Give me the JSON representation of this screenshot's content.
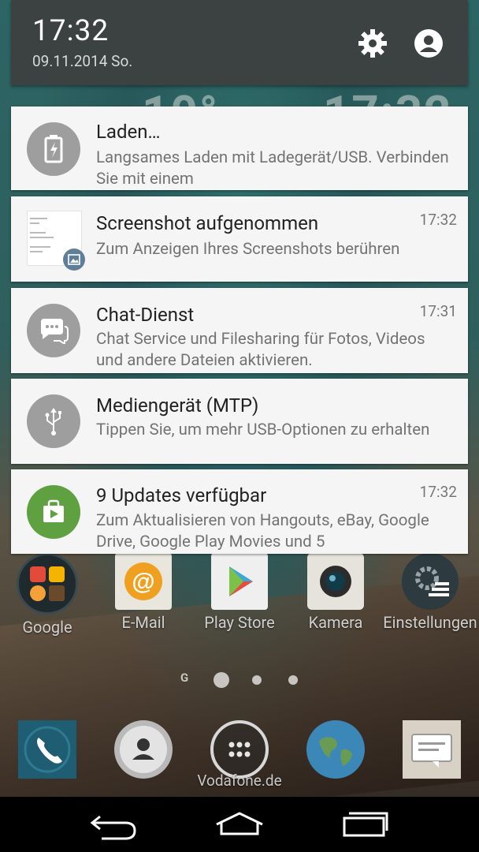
{
  "status": {
    "time": "17:32",
    "date": "09.11.2014 So."
  },
  "header_icons": [
    "gear-icon",
    "account-icon"
  ],
  "wallpaper": {
    "ghost_clock_left": "10°",
    "ghost_clock_right": "17:32"
  },
  "notifications": [
    {
      "title": "Laden…",
      "body": "Langsames Laden mit Ladegerät/USB. Verbinden Sie mit einem",
      "time": "",
      "icon": "battery-charging-icon"
    },
    {
      "title": "Screenshot aufgenommen",
      "body": "Zum Anzeigen Ihres Screenshots berühren",
      "time": "17:32",
      "icon": "image-icon"
    },
    {
      "title": "Chat-Dienst",
      "body": "Chat Service und Filesharing für Fotos, Videos und andere Dateien aktivieren.",
      "time": "17:31",
      "icon": "chat-bubbles-icon"
    },
    {
      "title": "Mediengerät (MTP)",
      "body": "Tippen Sie, um mehr USB-Optionen zu erhalten",
      "time": "",
      "icon": "usb-icon"
    },
    {
      "title": "9 Updates verfügbar",
      "body": "Zum Aktualisieren von Hangouts, eBay, Google Drive, Google Play Movies und 5",
      "time": "17:32",
      "icon": "play-store-bag-icon"
    }
  ],
  "home_apps": [
    {
      "label": "Google"
    },
    {
      "label": "E-Mail"
    },
    {
      "label": "Play Store"
    },
    {
      "label": "Kamera"
    },
    {
      "label": "Einstellungen"
    }
  ],
  "page_indicator": {
    "g_label": "G",
    "pages": 3,
    "current": 1
  },
  "dock": [
    "phone-icon",
    "contacts-icon",
    "app-drawer-icon",
    "browser-globe-icon",
    "messages-icon"
  ],
  "carrier": "Vodafone.de",
  "navbar": [
    "back-icon",
    "home-icon",
    "recent-apps-icon"
  ],
  "colors": {
    "header_bg": "#3c4242",
    "card_bg": "#f5f5f5",
    "avatar_gray": "#9e9e9e",
    "updates_green": "#5fa040",
    "screenshot_badge": "#5f7f98"
  }
}
